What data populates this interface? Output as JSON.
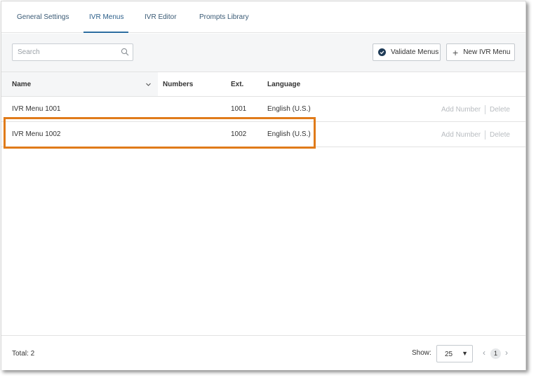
{
  "tabs": [
    {
      "label": "General Settings"
    },
    {
      "label": "IVR Menus",
      "active": true
    },
    {
      "label": "IVR Editor"
    },
    {
      "label": "Prompts Library"
    }
  ],
  "toolbar": {
    "search_placeholder": "Search",
    "search_value": "",
    "validate_label": "Validate Menus",
    "new_label": "New IVR Menu"
  },
  "table": {
    "columns": [
      "Name",
      "Numbers",
      "Ext.",
      "Language"
    ],
    "rows": [
      {
        "name": "IVR Menu 1001",
        "numbers": "",
        "ext": "1001",
        "language": "English (U.S.)",
        "add_number": "Add Number",
        "delete": "Delete"
      },
      {
        "name": "IVR Menu 1002",
        "numbers": "",
        "ext": "1002",
        "language": "English (U.S.)",
        "add_number": "Add Number",
        "delete": "Delete"
      }
    ]
  },
  "footer": {
    "total": "Total: 2",
    "show_label": "Show:",
    "page_size": "25",
    "current_page": "1"
  },
  "colors": {
    "accent": "#2c6da0",
    "highlight": "#e07b1a",
    "validate_check": "#1f3b57"
  },
  "icons": {
    "search": "search-icon",
    "sort": "chevron-down-icon",
    "validate": "check-circle-icon",
    "add": "plus-icon",
    "select": "caret-down-icon",
    "prev": "chevron-left-icon",
    "next": "chevron-right-icon"
  }
}
